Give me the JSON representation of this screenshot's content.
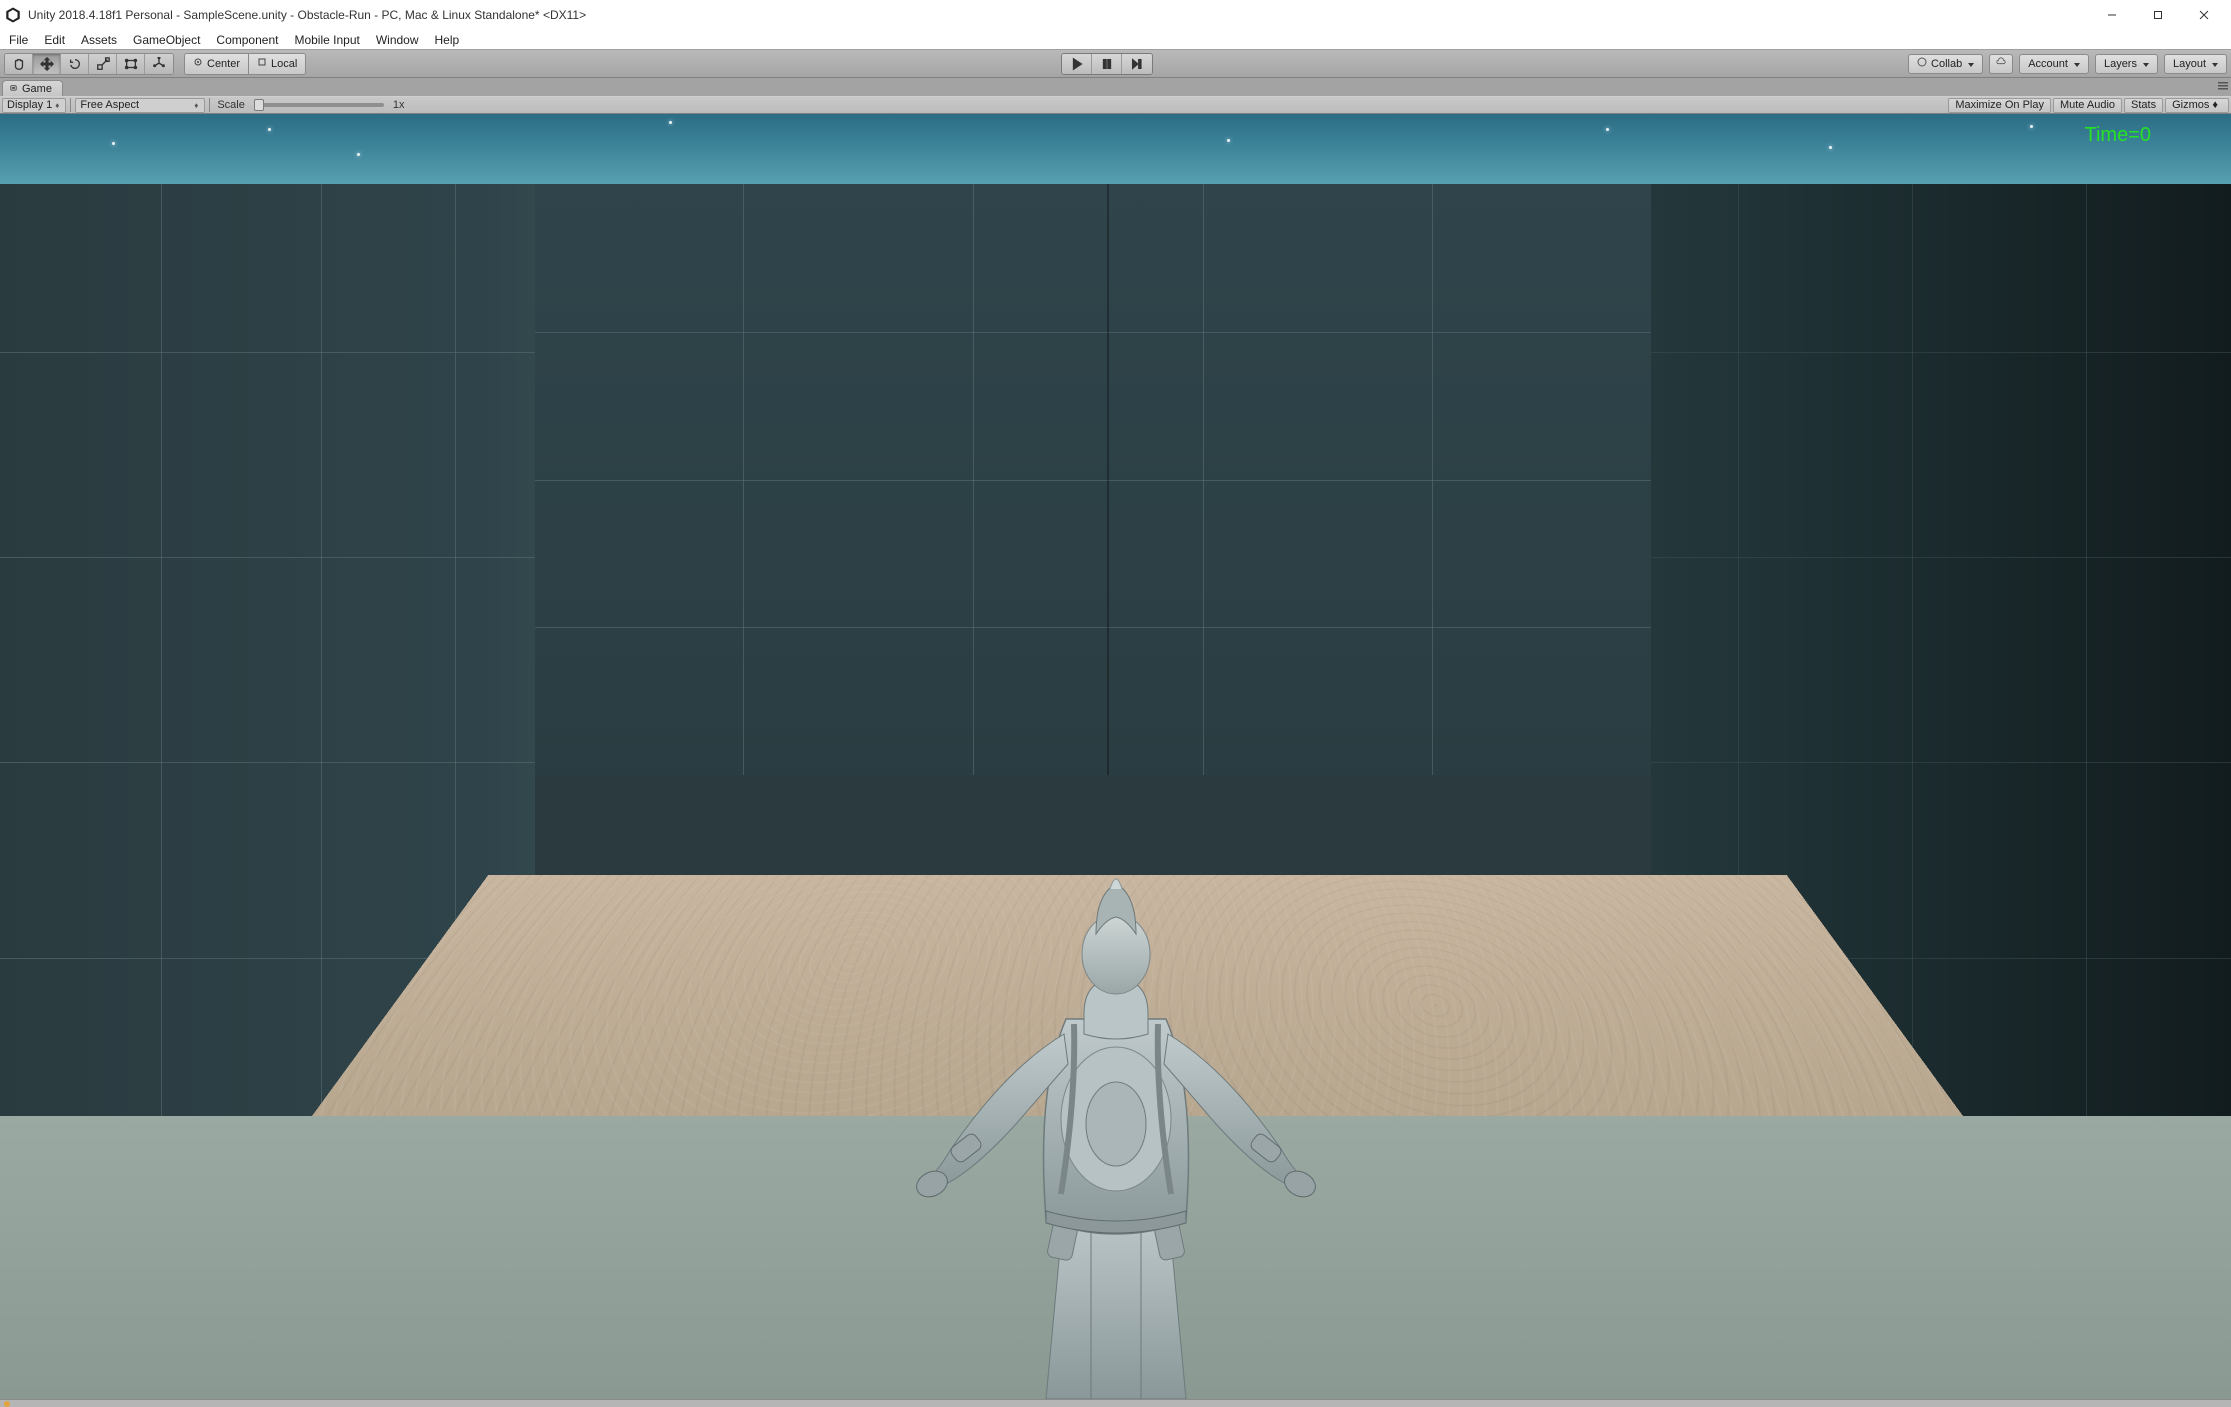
{
  "window": {
    "title": "Unity 2018.4.18f1 Personal - SampleScene.unity - Obstacle-Run - PC, Mac & Linux Standalone* <DX11>"
  },
  "menu": {
    "items": [
      "File",
      "Edit",
      "Assets",
      "GameObject",
      "Component",
      "Mobile Input",
      "Window",
      "Help"
    ]
  },
  "toolbar": {
    "pivot_handle": {
      "center": "Center",
      "local": "Local"
    },
    "collab": "Collab",
    "account": "Account",
    "layers": "Layers",
    "layout": "Layout"
  },
  "panel": {
    "game_tab": "Game"
  },
  "game_controls": {
    "display": "Display 1",
    "aspect": "Free Aspect",
    "scale_label": "Scale",
    "scale_value": "1x",
    "maximize": "Maximize On Play",
    "mute": "Mute Audio",
    "stats": "Stats",
    "gizmos": "Gizmos"
  },
  "overlay": {
    "time_label": "Time=0"
  }
}
